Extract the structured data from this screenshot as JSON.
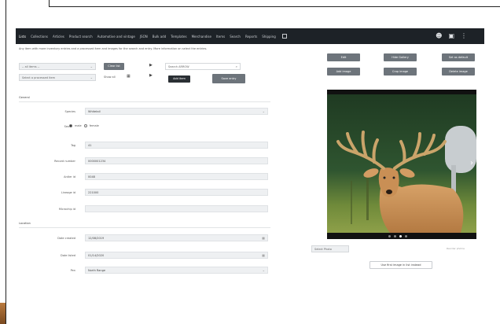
{
  "nav": {
    "items": [
      "Lists",
      "Collections",
      "Articles",
      "Product search",
      "Automotive and vintage",
      "JSON",
      "Bulk add",
      "Templates",
      "Merchandise",
      "Items",
      "Search",
      "Reports",
      "Shipping"
    ],
    "active_index": 0
  },
  "hint": "Any item with more inventory entries and a processed item and images for the search and entry. More information on select the entries.",
  "toolbar": {
    "select1": "-- all items --",
    "select2": "Select a processed item",
    "btn_clear": "Clear list",
    "btn_show": "Show all",
    "input_search": "Search ARROW",
    "btn_add": "Add item",
    "btn_save": "Save entry"
  },
  "sections": {
    "general": "General",
    "location": "Location"
  },
  "form": {
    "rows": [
      {
        "label": "Species",
        "value": "Whitetail"
      },
      {
        "label": "Tag",
        "value": "41"
      },
      {
        "label": "Record number",
        "value": "0000001234"
      },
      {
        "label": "Antler id",
        "value": "0048"
      },
      {
        "label": "Lineage id",
        "value": "221000"
      },
      {
        "label": "Microchip id",
        "value": ""
      }
    ],
    "sex_label": "Sex",
    "sex_male": "male",
    "sex_female": "female",
    "loc_rows": [
      {
        "label": "Date created",
        "value": "12/08/2019"
      },
      {
        "label": "Date listed",
        "value": "01/14/2020"
      },
      {
        "label": "Pen",
        "value": "North Range"
      }
    ]
  },
  "right_buttons": [
    [
      "Edit",
      "Hide Gallery",
      "Set as default"
    ],
    [
      "Add image",
      "Crop image",
      "Delete image"
    ]
  ],
  "photo": {
    "current_index": 2,
    "count": 4
  },
  "bottom": {
    "select": "Select Photo",
    "link": "Reorder photos",
    "button": "Use first image in list instead"
  },
  "colors": {
    "navbar": "#1d2227",
    "button": "#6d747b",
    "button_dark": "#2a2f34"
  }
}
